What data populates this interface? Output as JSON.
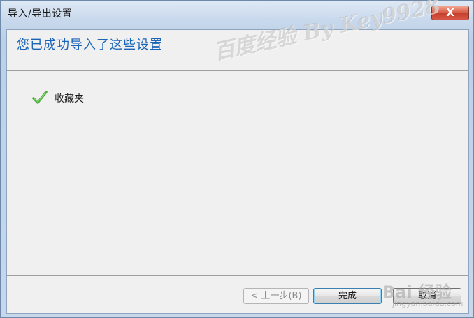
{
  "window": {
    "title": "导入/导出设置",
    "close_label": "X"
  },
  "content": {
    "heading": "您已成功导入了这些设置",
    "items": [
      {
        "label": "收藏夹",
        "icon": "checkmark-icon",
        "status": "success"
      }
    ]
  },
  "buttons": {
    "back": "< 上一步(B)",
    "finish": "完成",
    "cancel": "取消"
  },
  "watermark": {
    "text": "百度经验 By Key9928",
    "logo_text": "Bai 经验",
    "url": "jingyan.baidu.com"
  },
  "colors": {
    "heading": "#1b65b8",
    "check": "#4db03a",
    "close": "#c6402c"
  }
}
